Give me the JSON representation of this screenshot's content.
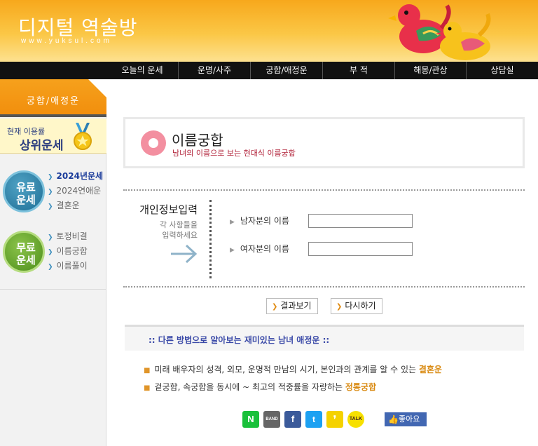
{
  "header": {
    "logo_title": "디지털 역술방",
    "logo_url": "www.yuksul.com"
  },
  "nav": {
    "items": [
      "오늘의 운세",
      "운명/사주",
      "궁합/애정운",
      "부 적",
      "해몽/관상",
      "상담실"
    ]
  },
  "sidebar": {
    "tab_label": "궁합/애정운",
    "popular_line1": "현재 이용률",
    "popular_line2": "상위운세",
    "paid_badge": "유료\n운세",
    "free_badge": "무료\n운세",
    "paid_badge_l1": "유료",
    "paid_badge_l2": "운세",
    "free_badge_l1": "무료",
    "free_badge_l2": "운세",
    "paid_items": [
      "2024년운세",
      "2024연애운",
      "결혼운"
    ],
    "free_items": [
      "토정비결",
      "이름궁합",
      "이름풀이"
    ]
  },
  "main": {
    "title": "이름궁합",
    "subtitle": "남녀의 이름으로 보는 현대식 이름궁합",
    "form_head": "개인정보입력",
    "form_hint_1": "각 사항들을",
    "form_hint_2": "입력하세요",
    "male_label": "남자분의 이름",
    "female_label": "여자분의 이름",
    "male_value": "",
    "female_value": "",
    "btn_view": "결과보기",
    "btn_reset": "다시하기",
    "alt_band": ":: 다른 방법으로 알아보는 재미있는 남녀 애정운 ::",
    "rec1_text": "미래 배우자의 성격, 외모, 운명적 만남의 시기, 본인과의 관계를 알 수 있는 ",
    "rec1_hl": "결혼운",
    "rec2_text": "겉궁합, 속궁합을 동시에 ~ 최고의 적중률을 자랑하는 ",
    "rec2_hl": "정통궁합",
    "like_label": "좋아요"
  },
  "share": {
    "naver": "N",
    "band": "BAND",
    "facebook": "f",
    "twitter": "t",
    "kakaostory": "❜",
    "kakaotalk": "TALK"
  },
  "colors": {
    "header_top": "#f7a81c",
    "nav_bg": "#111111",
    "accent_orange": "#f18d0c",
    "subtitle_red": "#b2243b",
    "link_blue": "#1a3b9a",
    "highlight": "#d98a12"
  }
}
